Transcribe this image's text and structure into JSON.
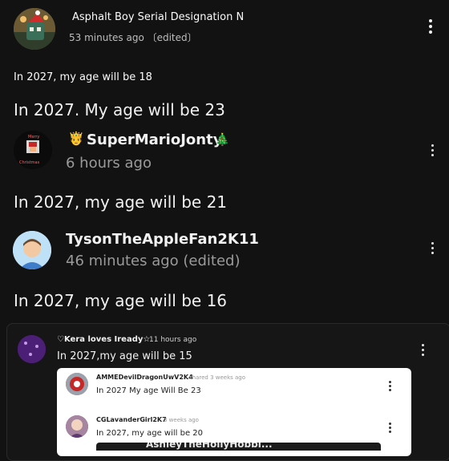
{
  "comments": [
    {
      "author": "Asphalt Boy Serial Designation N",
      "meta": "53 minutes ago 〔edited〕",
      "text": "In 2027, my age will be 18"
    },
    {
      "author": "SuperMarioJonty",
      "author_badge_emoji": "🤴",
      "author_suffix_emoji": "🎄",
      "pre_text": "In 2027. My age will be 23",
      "meta": "6 hours ago",
      "text": "In 2027, my age will be 21",
      "avatar_caption_top": "Merry",
      "avatar_caption_bottom": "Christmas"
    },
    {
      "author": "TysonTheAppleFan2K11",
      "meta": "46 minutes ago (edited)",
      "text": "In 2027, my age will be 16"
    }
  ],
  "embedded_card": {
    "author": "♡Kera loves Iready☆",
    "meta": "11 hours ago",
    "text": "In 2027,my age will be 15",
    "inner": [
      {
        "author": "AMMEDevilDragonUwV2K4",
        "meta": "shared 3 weeks ago",
        "text": "In 2027 My age Will Be 23"
      },
      {
        "author": "CGLavanderGirl2K7",
        "meta": "3 weeks ago",
        "text": "In 2027, my age will be 20"
      }
    ],
    "bottom_banner": "AshleyTheHollyHobbi..."
  },
  "colors": {
    "background": "#121212",
    "text": "#f1f1f1",
    "meta": "#aaaaaa",
    "card_background": "#161616",
    "inner_card_background": "#ffffff"
  },
  "icons": [
    "more-vertical-icon",
    "tree-emoji",
    "crown-emoji"
  ]
}
